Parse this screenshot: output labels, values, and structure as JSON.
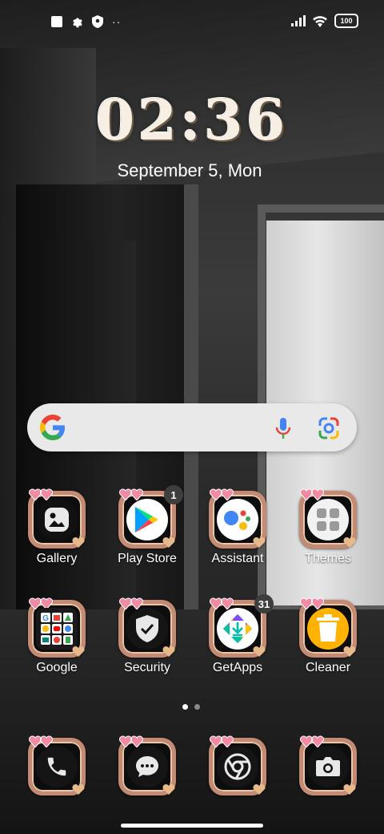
{
  "status_bar": {
    "left_icons": [
      "square-notification-icon",
      "gear-icon",
      "shield-icon",
      "more-dots-icon"
    ],
    "right_icons": [
      "signal-icon",
      "wifi-icon",
      "battery-icon"
    ],
    "more_dots": "··",
    "battery_level": "100"
  },
  "clock": {
    "time": "02:36",
    "date": "September 5, Mon"
  },
  "search": {
    "icons": [
      "google-g-icon",
      "mic-icon",
      "google-lens-icon"
    ]
  },
  "apps": {
    "gallery": {
      "label": "Gallery"
    },
    "play_store": {
      "label": "Play Store",
      "badge": "1"
    },
    "assistant": {
      "label": "Assistant"
    },
    "themes": {
      "label": "Themes"
    },
    "google": {
      "label": "Google"
    },
    "security": {
      "label": "Security"
    },
    "getapps": {
      "label": "GetApps",
      "badge": "31"
    },
    "cleaner": {
      "label": "Cleaner"
    }
  },
  "dock": {
    "apps": [
      "phone-icon",
      "messages-icon",
      "chrome-icon",
      "camera-icon"
    ]
  },
  "pager": {
    "pages": 2,
    "current": 1
  },
  "colors": {
    "frame": "#c48a73",
    "search_bg": "#e9e9ea",
    "badge": "#3e3e3e"
  }
}
